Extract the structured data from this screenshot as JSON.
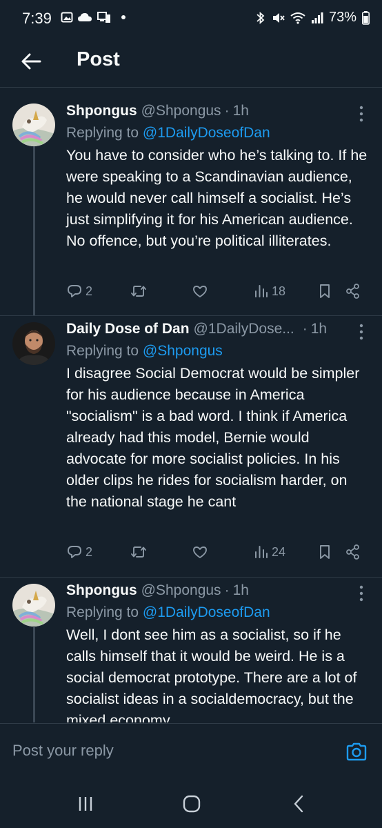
{
  "status": {
    "time": "7:39",
    "battery": "73%"
  },
  "header": {
    "title": "Post"
  },
  "tweets": [
    {
      "name": "Shpongus",
      "handle": "@Shpongus",
      "separator": "·",
      "time": "1h",
      "replying_label": "Replying to",
      "replying_to": "@1DailyDoseofDan",
      "text": "You have to consider who he’s talking to. If he were speaking to a Scandinavian audience, he would never call himself a socialist. He’s just simplifying it for his American audience. No offence, but you’re political illiterates.",
      "replies": "2",
      "views": "18"
    },
    {
      "name": "Daily Dose of Dan",
      "handle": "@1DailyDose...",
      "separator": "·",
      "time": "1h",
      "replying_label": "Replying to",
      "replying_to": "@Shpongus",
      "text": "I disagree Social Democrat would be simpler for his audience because in America \"socialism\" is a bad word. I think if America already had this model, Bernie would advocate for more socialist policies. In his older clips he rides for socialism harder, on the national stage he cant",
      "replies": "2",
      "views": "24"
    },
    {
      "name": "Shpongus",
      "handle": "@Shpongus",
      "separator": "·",
      "time": "1h",
      "replying_label": "Replying to",
      "replying_to": "@1DailyDoseofDan",
      "text": "Well, I dont see him as a socialist, so if he calls himself that it would be weird. He is a social democrat prototype. There are a lot of socialist ideas in a socialdemocracy, but the mixed economy"
    }
  ],
  "reply_bar": {
    "placeholder": "Post your reply"
  },
  "colors": {
    "background": "#15202b",
    "accent": "#1d9bf0",
    "muted": "#8b98a5",
    "text": "#f7f9f9"
  },
  "icons": {
    "back": "arrow-left-icon",
    "more": "more-vertical-icon",
    "reply": "reply-icon",
    "retweet": "retweet-icon",
    "like": "heart-icon",
    "views": "views-icon",
    "bookmark": "bookmark-icon",
    "share": "share-icon",
    "camera": "camera-icon"
  }
}
